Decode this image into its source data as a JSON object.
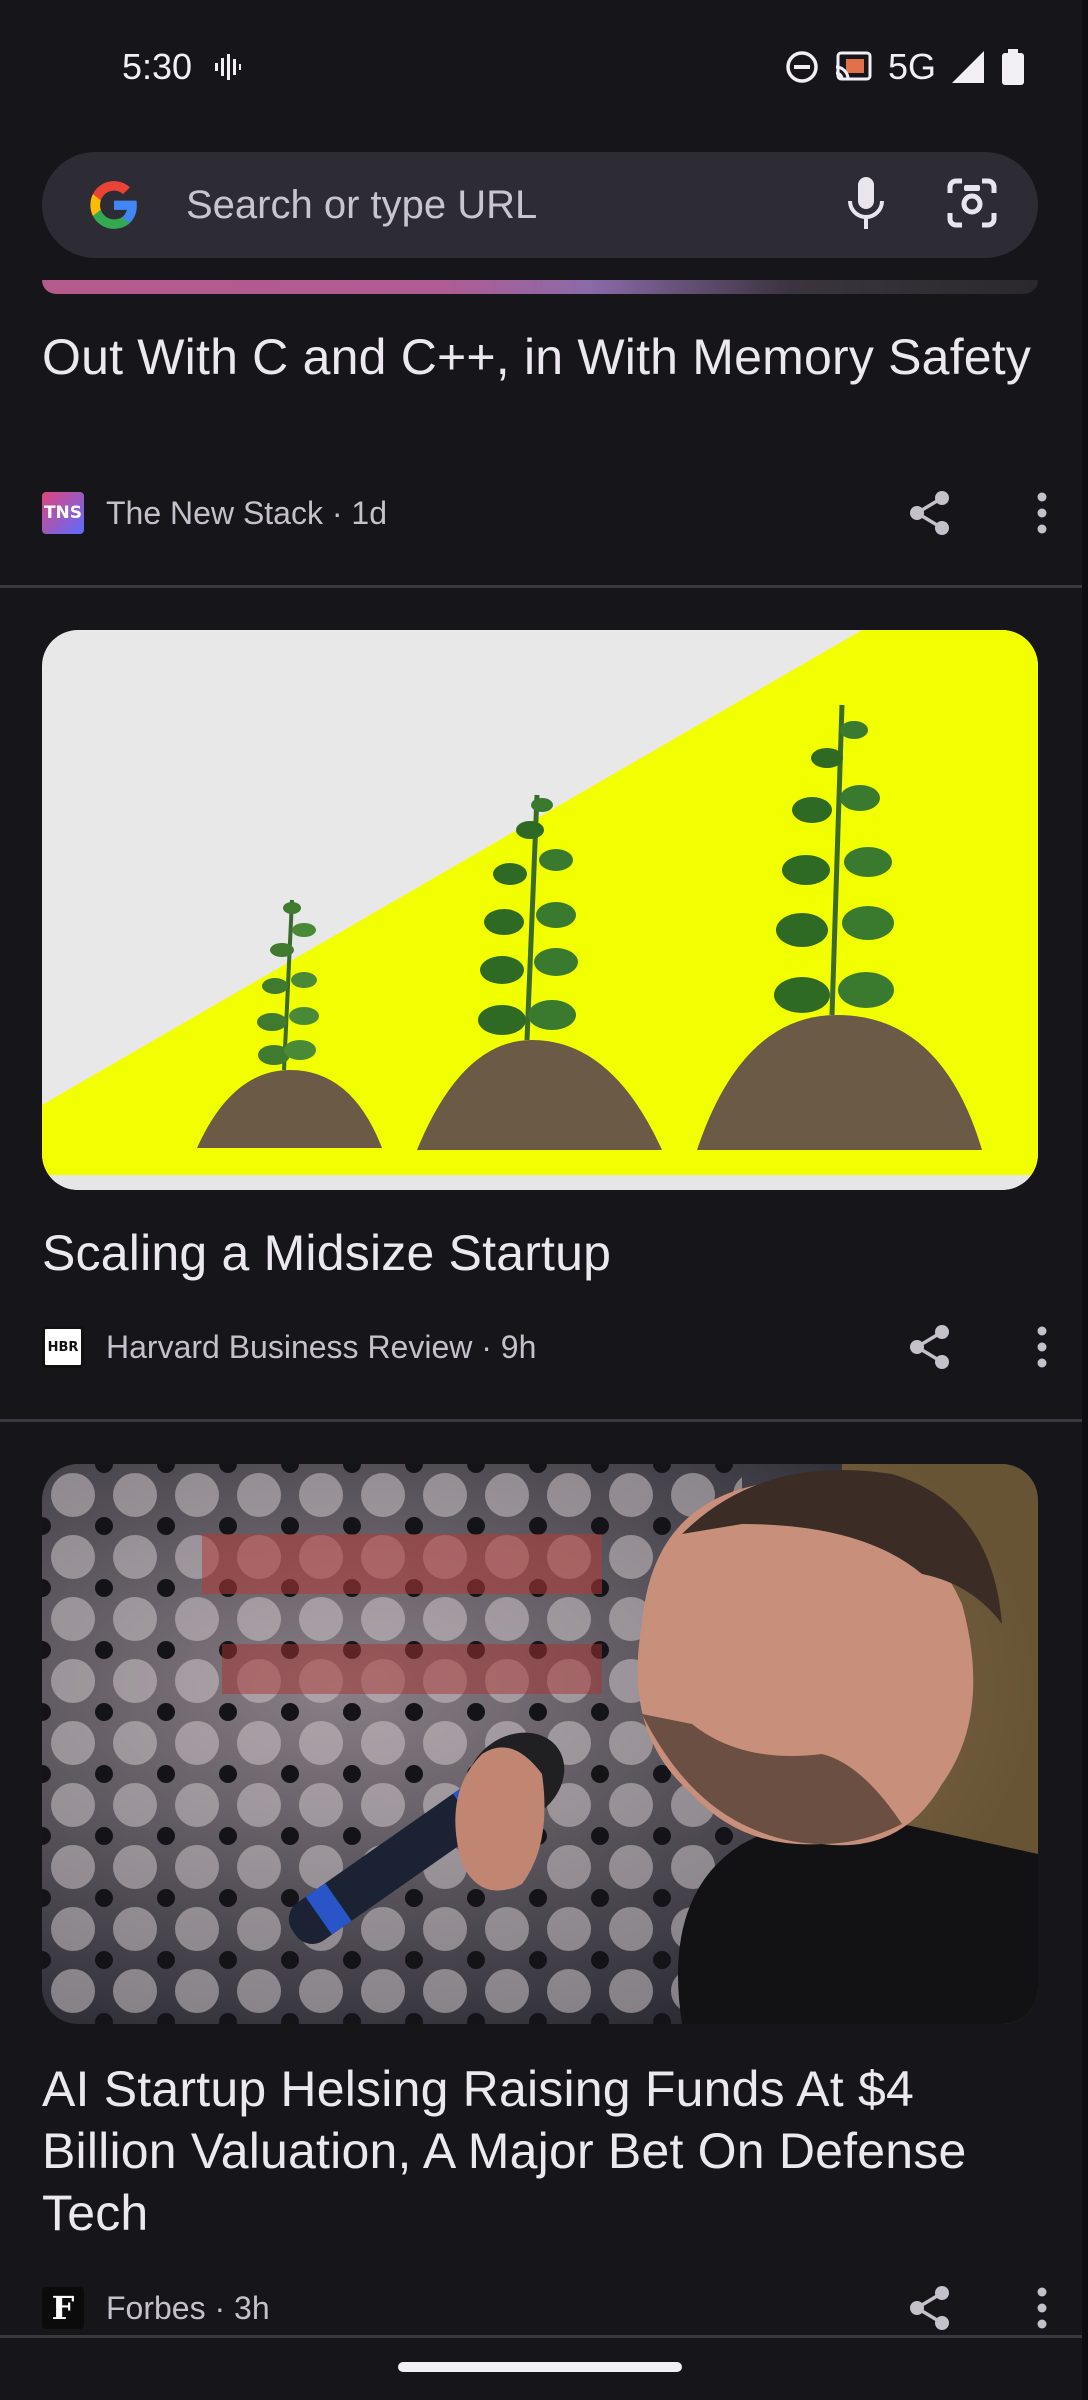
{
  "status_bar": {
    "time": "5:30",
    "network": "5G",
    "icons": [
      "voice-activity-icon",
      "do-not-disturb-icon",
      "cast-icon",
      "signal-icon",
      "battery-icon"
    ]
  },
  "search": {
    "placeholder": "Search or type URL",
    "icons": [
      "google-logo-icon",
      "mic-icon",
      "lens-icon"
    ]
  },
  "articles": [
    {
      "title": "Out With C and C++, in With Memory Safety",
      "publisher": "The New Stack · 1d",
      "logo_text": "TNS"
    },
    {
      "title": "Scaling a Midsize Startup",
      "publisher": "Harvard Business Review · 9h",
      "logo_text": "HBR"
    },
    {
      "title": "AI Startup Helsing Raising Funds At $4 Billion Valuation, A Major Bet On Defense Tech",
      "publisher": "Forbes · 3h",
      "logo_text": "F"
    }
  ],
  "colors": {
    "background": "#16151a",
    "search_bg": "#2d2b33",
    "text": "#ebe8ef",
    "secondary_text": "#c5c1ca",
    "image_yellow": "#f2ff00"
  }
}
